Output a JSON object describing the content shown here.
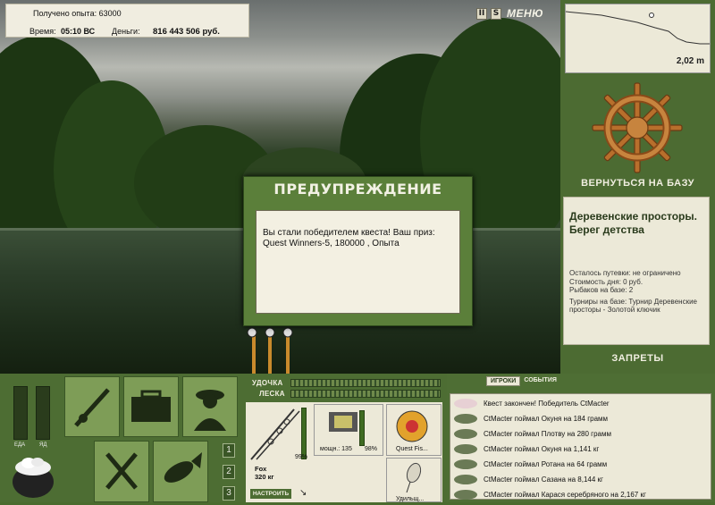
{
  "header": {
    "xp_label": "Получено опыта:",
    "xp_value": "63000",
    "time_label": "Время:",
    "time_value": "05:10 ВС",
    "money_label": "Деньги:",
    "money_value": "816 443 506 руб."
  },
  "topbar": {
    "pause_label": "II",
    "sound_label": "S",
    "menu_label": "МЕНЮ"
  },
  "depth": {
    "value": "2,02 m"
  },
  "right_panel": {
    "back_label": "ВЕРНУТЬСЯ НА БАЗУ",
    "location_title": "Деревенские просторы. Берег детства",
    "lines": [
      "Осталось путевки: не ограничено",
      "Стоимость дня: 0 руб.",
      "Рыбаков на базе: 2",
      "Турниры на базе: Турнир Деревенские просторы - Золотой ключик"
    ],
    "bans_label": "ЗАПРЕТЫ"
  },
  "dialog": {
    "title": "ПРЕДУПРЕЖДЕНИЕ",
    "message": "Вы стали победителем квеста! Ваш приз: Quest Winners-5, 180000 , Опыта"
  },
  "bars": {
    "food_label": "ЕДА",
    "poison_label": "ЯД"
  },
  "slots": {
    "n1": "1",
    "n2": "2",
    "n3": "3"
  },
  "rod": {
    "rod_label": "УДОЧКА",
    "line_label": "ЛЕСКА",
    "rod_name": "Fox",
    "rod_weight": "320 кг",
    "rod_pct": "99%",
    "adjust_label": "НАСТРОИТЬ",
    "reel_text": "мощн.: 135",
    "reel_pct": "98%",
    "line_name": "Quest Fis...",
    "lure_name": "Удильщ..."
  },
  "log": {
    "tab_players": "ИГРОКИ",
    "tab_events": "СОБЫТИЯ",
    "entries": [
      "Квест закончен! Победитель CtMacter",
      "CtMacter поймал Окуня на 184 грамм",
      "CtMacter поймал Плотву на 280 грамм",
      "CtMacter поймал Окуня на 1,141 кг",
      "CtMacter поймал Ротана на 64 грамм",
      "CtMacter поймал Сазана на 8,144 кг",
      "CtMacter поймал Карася серебряного на 2,167 кг"
    ]
  },
  "colors": {
    "panel_green": "#4d6d33",
    "paper": "#ece9d8",
    "dialog_green": "#5b7f3a"
  }
}
